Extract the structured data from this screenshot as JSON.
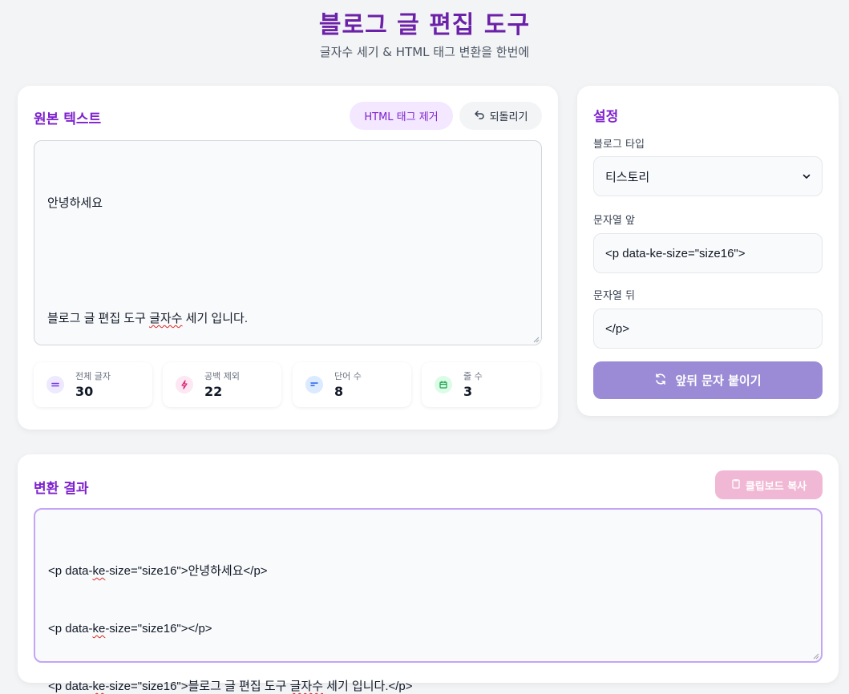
{
  "header": {
    "title": "블로그 글 편집 도구",
    "subtitle": "글자수 세기 & HTML 태그 변환을 한번에"
  },
  "source": {
    "title": "원본 텍스트",
    "remove_tags_label": "HTML 태그 제거",
    "undo_label": "되돌리기",
    "lines": [
      "안녕하세요",
      "",
      "블로그 글 편집 도구 ",
      "글자수",
      " 세기 입니다."
    ]
  },
  "stats": [
    {
      "label": "전체 글자",
      "value": "30",
      "icon": "equals-icon",
      "color": "#7c3aed",
      "bg": "#ede9fe"
    },
    {
      "label": "공백 제외",
      "value": "22",
      "icon": "lightning-icon",
      "color": "#db2777",
      "bg": "#fce7f3"
    },
    {
      "label": "단어 수",
      "value": "8",
      "icon": "align-left-icon",
      "color": "#2563eb",
      "bg": "#dbeafe"
    },
    {
      "label": "줄 수",
      "value": "3",
      "icon": "calendar-icon",
      "color": "#16a34a",
      "bg": "#dcfce7"
    }
  ],
  "settings": {
    "title": "설정",
    "blog_type_label": "블로그 타입",
    "blog_type_value": "티스토리",
    "prefix_label": "문자열 앞",
    "prefix_value": "<p data-ke-size=\"size16\">",
    "suffix_label": "문자열 뒤",
    "suffix_value": "</p>",
    "apply_label": "앞뒤 문자 붙이기"
  },
  "result": {
    "title": "변환 결과",
    "copy_label": "클립보드 복사",
    "line1_pre": "<p data-",
    "line1_ke": "ke",
    "line1_post": "-size=\"size16\">안녕하세요</p>",
    "line2_pre": "<p data-",
    "line2_ke": "ke",
    "line2_post": "-size=\"size16\"></p>",
    "line3_pre": "<p data-",
    "line3_ke": "ke",
    "line3_mid": "-size=\"size16\">블로그 글 편집 도구 ",
    "line3_word": "글자수",
    "line3_post": " 세기 입니다.</p>"
  },
  "colors": {
    "accent": "#7e22ce",
    "apply_button": "#9b8bd6",
    "copy_button": "#f0b8d4",
    "remove_tags_bg": "#f3e8ff"
  }
}
